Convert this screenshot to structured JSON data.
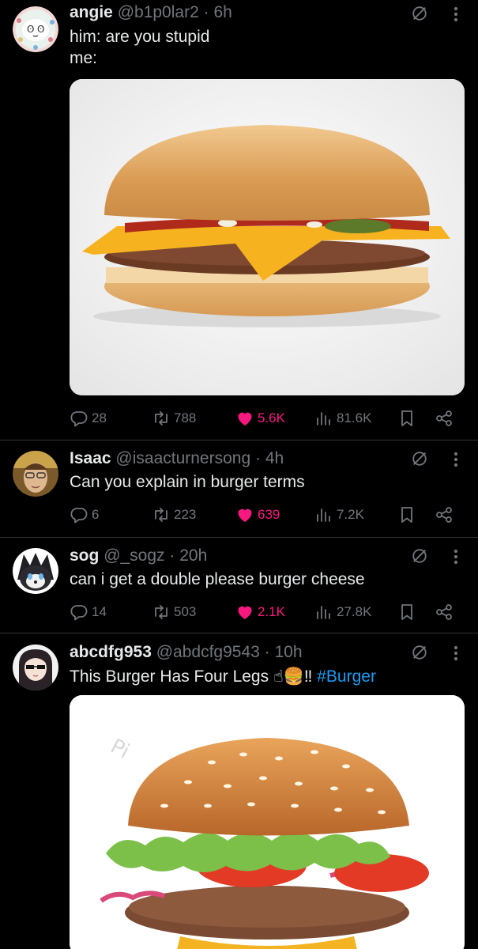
{
  "colors": {
    "background": "#000000",
    "text": "#e7e9ea",
    "muted": "#71767b",
    "like": "#f91880",
    "link": "#1d9bf0",
    "divider": "#2f3336"
  },
  "tweets": [
    {
      "name": "angie",
      "handle": "@b1p0lar2",
      "sep": "·",
      "time": "6h",
      "text_lines": [
        "him: are you stupid",
        "me:"
      ],
      "image": "cheeseburger photo",
      "replies": "28",
      "retweets": "788",
      "likes": "5.6K",
      "views": "81.6K"
    },
    {
      "name": "Isaac",
      "handle": "@isaacturnersong",
      "sep": "·",
      "time": "4h",
      "text": "Can you explain in burger terms",
      "replies": "6",
      "retweets": "223",
      "likes": "639",
      "views": "7.2K"
    },
    {
      "name": "sog",
      "handle": "@_sogz",
      "sep": "·",
      "time": "20h",
      "text": "can i get a double please burger cheese",
      "replies": "14",
      "retweets": "503",
      "likes": "2.1K",
      "views": "27.8K"
    },
    {
      "name": "abcdfg953",
      "handle": "@abdcfg9543",
      "sep": "·",
      "time": "10h",
      "text": "This Burger Has Four Legs",
      "emojis": "☝🍔‼",
      "hashtag": "#Burger",
      "image": "burger photo",
      "watermark": "Pi"
    }
  ],
  "icons": [
    "mute-icon",
    "more-icon",
    "reply-icon",
    "retweet-icon",
    "like-icon",
    "views-icon",
    "bookmark-icon",
    "share-icon"
  ]
}
